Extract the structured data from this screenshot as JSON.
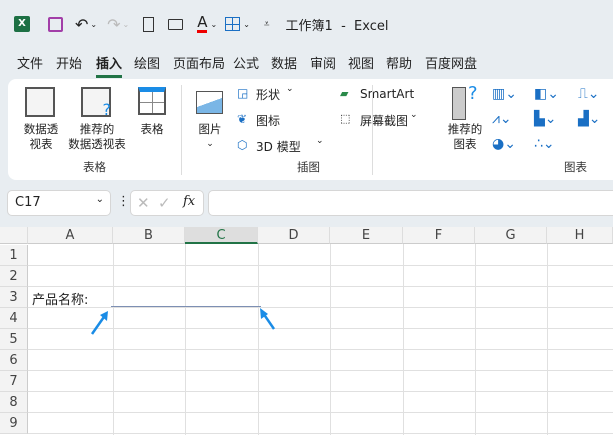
{
  "title": "工作簿1  -  Excel",
  "tabs": [
    "文件",
    "开始",
    "插入",
    "绘图",
    "页面布局",
    "公式",
    "数据",
    "审阅",
    "视图",
    "帮助",
    "百度网盘"
  ],
  "active_tab": "插入",
  "ribbon": {
    "pivot": "数据透\n视表",
    "recommended_pivot": "推荐的\n数据透视表",
    "table": "表格",
    "group_tables": "表格",
    "picture": "图片",
    "shapes": "形状",
    "icons": "图标",
    "model3d": "3D 模型",
    "smartart": "SmartArt",
    "screenshot": "屏幕截图",
    "group_illustrations": "插图",
    "recommended_charts": "推荐的\n图表",
    "group_charts": "图表"
  },
  "formula_bar": {
    "name_box": "C17",
    "fx": "fx",
    "value": ""
  },
  "columns": [
    "A",
    "B",
    "C",
    "D",
    "E",
    "F",
    "G",
    "H"
  ],
  "rows": [
    "1",
    "2",
    "3",
    "4",
    "5",
    "6",
    "7",
    "8",
    "9"
  ],
  "cells": {
    "A3": "产品名称:"
  },
  "colors": {
    "accent": "#217346",
    "arrow": "#1a8ce6"
  }
}
